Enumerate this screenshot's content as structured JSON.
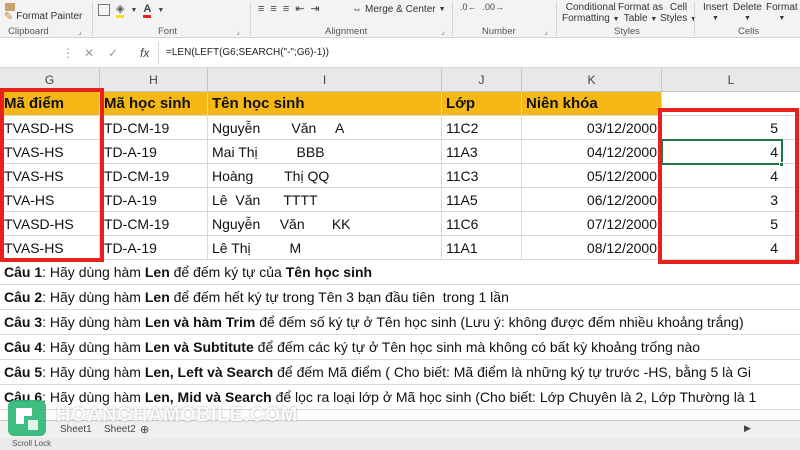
{
  "ribbon": {
    "format_painter": "Format Painter",
    "clipboard": "Clipboard",
    "font": "Font",
    "alignment": "Alignment",
    "merge_center": "Merge & Center",
    "number": "Number",
    "conditional": "Conditional",
    "formatting": "Formatting",
    "format_as": "Format as",
    "table": "Table",
    "cell": "Cell",
    "styles_btn": "Styles",
    "styles": "Styles",
    "insert": "Insert",
    "delete": "Delete",
    "format": "Format",
    "cells": "Cells"
  },
  "formula_bar": {
    "fx": "fx",
    "formula": "=LEN(LEFT(G6;SEARCH(\"-\";G6)-1))"
  },
  "columns": [
    "G",
    "H",
    "I",
    "J",
    "K",
    "L"
  ],
  "table": {
    "headers": [
      "Mã điểm",
      "Mã học sinh",
      "Tên học sinh",
      "Lớp",
      "Niên khóa"
    ],
    "rows": [
      [
        "TVASD-HS",
        "TD-CM-19",
        "Nguyễn        Văn     A",
        "11C2",
        "03/12/2000",
        "5"
      ],
      [
        "TVAS-HS",
        "TD-A-19",
        "Mai Thị          BBB",
        "11A3",
        "04/12/2000",
        "4"
      ],
      [
        "TVAS-HS",
        "TD-CM-19",
        "Hoàng        Thị QQ",
        "11C3",
        "05/12/2000",
        "4"
      ],
      [
        "TVA-HS",
        "TD-A-19",
        "Lê  Văn      TTTT",
        "11A5",
        "06/12/2000",
        "3"
      ],
      [
        "TVASD-HS",
        "TD-CM-19",
        "Nguyễn     Văn       KK",
        "11C6",
        "07/12/2000",
        "5"
      ],
      [
        "TVAS-HS",
        "TD-A-19",
        "Lê Thị          M",
        "11A1",
        "08/12/2000",
        "4"
      ]
    ]
  },
  "questions": [
    {
      "label": "Câu 1",
      "text_1": ": Hãy dùng hàm ",
      "bold_1": "Len",
      "text_2": " để đếm ký tự của ",
      "bold_2": "Tên học sinh",
      "text_3": ""
    },
    {
      "label": "Câu 2",
      "text_1": ": Hãy dùng hàm ",
      "bold_1": "Len",
      "text_2": " để đếm hết ký tự trong Tên 3 bạn đầu tiên  trong 1 lần",
      "bold_2": "",
      "text_3": ""
    },
    {
      "label": "Câu 3",
      "text_1": ": Hãy dùng hàm ",
      "bold_1": "Len và hàm Trim",
      "text_2": " để đếm số ký tự ở Tên học sinh (Lưu ý: không được đếm nhiều khoảng trắng)",
      "bold_2": "",
      "text_3": ""
    },
    {
      "label": "Câu 4",
      "text_1": ": Hãy dùng hàm ",
      "bold_1": "Len và Subtitute",
      "text_2": " để đếm các ký tự ở Tên học sinh mà không có bất kỳ khoảng trống nào",
      "bold_2": "",
      "text_3": ""
    },
    {
      "label": "Câu 5",
      "text_1": ": Hãy dùng hàm ",
      "bold_1": "Len, Left và Search",
      "text_2": " để đếm Mã điểm ( Cho biết: Mã điểm là những ký tự trước -HS, bằng 5 là Gi",
      "bold_2": "",
      "text_3": ""
    },
    {
      "label": "Câu 6",
      "text_1": ": Hãy dùng hàm ",
      "bold_1": "Len, Mid và Search",
      "text_2": " để lọc ra loại lớp ở Mã học sinh (Cho biết: Lớp Chuyên là 2, Lớp Thường là 1",
      "bold_2": "",
      "text_3": ""
    }
  ],
  "sheet_tabs": [
    "Sheet1",
    "Sheet2"
  ],
  "status": "Scroll Lock",
  "watermark": "HOANGHAMOBILE.COM",
  "colors": {
    "header_fill": "#f5b716",
    "highlight": "#e8211c",
    "selection": "#217346",
    "watermark": "#2bb673"
  }
}
